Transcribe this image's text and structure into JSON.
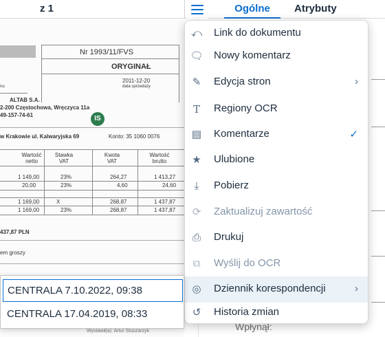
{
  "toolbar": {
    "page_indicator": "z 1",
    "tabs": [
      {
        "label": "Ogólne",
        "active": true
      },
      {
        "label": "Atrybuty",
        "active": false
      }
    ]
  },
  "document": {
    "invoice_number": "Nr 1993/11/FVS",
    "original_label": "ORYGINAŁ",
    "issue_date": "2011-12-20",
    "issue_date_caption": "data sprzedaży",
    "left_caption": "nu",
    "seller_name": "ALTAB S.A.",
    "seller_address": "2-200 Częstochowa, Wręczyca 11a",
    "seller_phone": "49-157-74-61",
    "bank_line": "w Krakowie ul. Kalwaryjska 69",
    "account_label": "Konto: 35 1060 0076",
    "table_headers": [
      "Wartość netto",
      "Stawka VAT",
      "Kwota VAT",
      "Wartość brutto"
    ],
    "table_rows": [
      [
        "1 149,00",
        "23%",
        "264,27",
        "1 413,27"
      ],
      [
        "20,00",
        "23%",
        "4,60",
        "24,60"
      ],
      [
        "1 169,00",
        "X",
        "268,87",
        "1 437,87"
      ],
      [
        "1 169,00",
        "23%",
        "268,87",
        "1 437,87"
      ]
    ],
    "total": "437,87 PLN",
    "in_words": "em groszy",
    "issued_by": "Wystawił(a): Artur Stuszarzyk",
    "user_badge": "IS"
  },
  "menu": {
    "items": [
      {
        "label": "Link do dokumentu",
        "icon": "link-icon"
      },
      {
        "label": "Nowy komentarz",
        "icon": "new-comment-icon"
      },
      {
        "label": "Edycja stron",
        "icon": "edit-icon",
        "submenu": true
      },
      {
        "label": "Regiony OCR",
        "icon": "text-icon"
      },
      {
        "label": "Komentarze",
        "icon": "comments-icon",
        "checked": true
      },
      {
        "label": "Ulubione",
        "icon": "star-icon"
      },
      {
        "label": "Pobierz",
        "icon": "download-icon"
      },
      {
        "label": "Zaktualizuj zawartość",
        "icon": "refresh-icon",
        "disabled": true
      },
      {
        "label": "Drukuj",
        "icon": "print-icon"
      },
      {
        "label": "Wyślij do OCR",
        "icon": "send-ocr-icon",
        "disabled": true
      },
      {
        "label": "Dziennik korespondencji",
        "icon": "journal-icon",
        "submenu": true,
        "hovered": true
      },
      {
        "label": "Historia zmian",
        "icon": "history-icon"
      }
    ]
  },
  "history_popup": {
    "entries": [
      {
        "label": "CENTRALA 7.10.2022, 09:38",
        "selected": true
      },
      {
        "label": "CENTRALA 17.04.2019, 08:33",
        "selected": false
      }
    ]
  },
  "right_panel": {
    "field_label": "Wpłynął:"
  },
  "colors": {
    "accent": "#0a6ed1",
    "text": "#1d2d3e",
    "disabled_text": "#8396a8",
    "hover_bg": "#eaf1f7",
    "user_badge": "#2e7d4f"
  }
}
